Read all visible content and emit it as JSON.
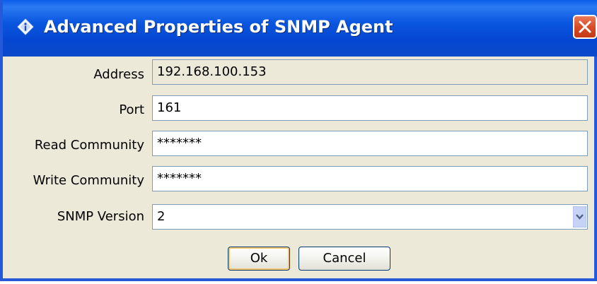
{
  "window": {
    "title": "Advanced Properties of SNMP Agent",
    "title_icon": "diamond-info-icon",
    "close_icon": "close-icon"
  },
  "form": {
    "address": {
      "label": "Address",
      "value": "192.168.100.153"
    },
    "port": {
      "label": "Port",
      "value": "161"
    },
    "read_community": {
      "label": "Read Community",
      "value": "*******"
    },
    "write_community": {
      "label": "Write Community",
      "value": "*******"
    },
    "snmp_version": {
      "label": "SNMP Version",
      "value": "2"
    }
  },
  "buttons": {
    "ok": "Ok",
    "cancel": "Cancel"
  },
  "colors": {
    "titlebar": "#0a56df",
    "dialog_bg": "#ece9d8",
    "close_red": "#d64a24",
    "field_border": "#7f9db9"
  }
}
